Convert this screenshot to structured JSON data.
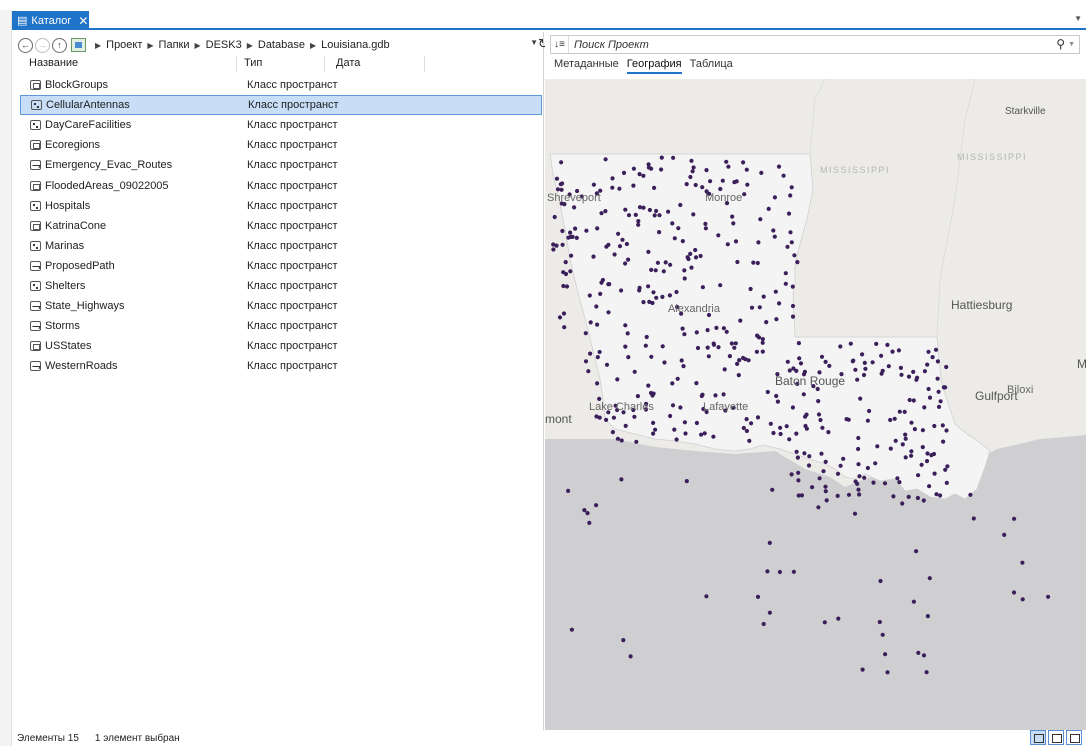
{
  "window": {
    "tab_title": "Каталог"
  },
  "address": {
    "crumbs": [
      "Проект",
      "Папки",
      "DESK3",
      "Database",
      "Louisiana.gdb"
    ]
  },
  "columns": {
    "name": "Название",
    "type": "Тип",
    "date": "Дата"
  },
  "items": [
    {
      "name": "BlockGroups",
      "type": "Класс пространст",
      "icon": "polygon"
    },
    {
      "name": "CellularAntennas",
      "type": "Класс пространст",
      "icon": "point",
      "selected": true
    },
    {
      "name": "DayCareFacilities",
      "type": "Класс пространст",
      "icon": "point"
    },
    {
      "name": "Ecoregions",
      "type": "Класс пространст",
      "icon": "polygon"
    },
    {
      "name": "Emergency_Evac_Routes",
      "type": "Класс пространст",
      "icon": "line"
    },
    {
      "name": "FloodedAreas_09022005",
      "type": "Класс пространст",
      "icon": "polygon"
    },
    {
      "name": "Hospitals",
      "type": "Класс пространст",
      "icon": "point"
    },
    {
      "name": "KatrinaCone",
      "type": "Класс пространст",
      "icon": "polygon"
    },
    {
      "name": "Marinas",
      "type": "Класс пространст",
      "icon": "point"
    },
    {
      "name": "ProposedPath",
      "type": "Класс пространст",
      "icon": "line"
    },
    {
      "name": "Shelters",
      "type": "Класс пространст",
      "icon": "point"
    },
    {
      "name": "State_Highways",
      "type": "Класс пространст",
      "icon": "line"
    },
    {
      "name": "Storms",
      "type": "Класс пространст",
      "icon": "line"
    },
    {
      "name": "USStates",
      "type": "Класс пространст",
      "icon": "polygon"
    },
    {
      "name": "WesternRoads",
      "type": "Класс пространст",
      "icon": "line"
    }
  ],
  "search": {
    "placeholder": "Поиск Проект"
  },
  "preview_tabs": [
    {
      "label": "Метаданные",
      "active": false
    },
    {
      "label": "География",
      "active": true
    },
    {
      "label": "Таблица",
      "active": false
    }
  ],
  "map_labels": {
    "starkville": "Starkville",
    "mississippi1": "MISSISSIPPI",
    "mississippi2": "MISSISSIPPI",
    "shreveport": "Shreveport",
    "monroe": "Monroe",
    "alexandria": "Alexandria",
    "hattiesburg": "Hattiesburg",
    "baton_rouge": "Baton Rouge",
    "lake_charles": "Lake Charles",
    "lafayette": "Lafayette",
    "gulfport": "Gulfport",
    "biloxi": "Biloxi",
    "mont": "mont",
    "m": "M"
  },
  "status": {
    "count": "Элементы 15",
    "selection": "1 элемент выбран"
  },
  "colors": {
    "accent": "#1f73c9",
    "point": "#3b1f5a",
    "land": "#ecebe8",
    "water": "#cfcfd2",
    "louisiana": "#f4f4f4"
  }
}
